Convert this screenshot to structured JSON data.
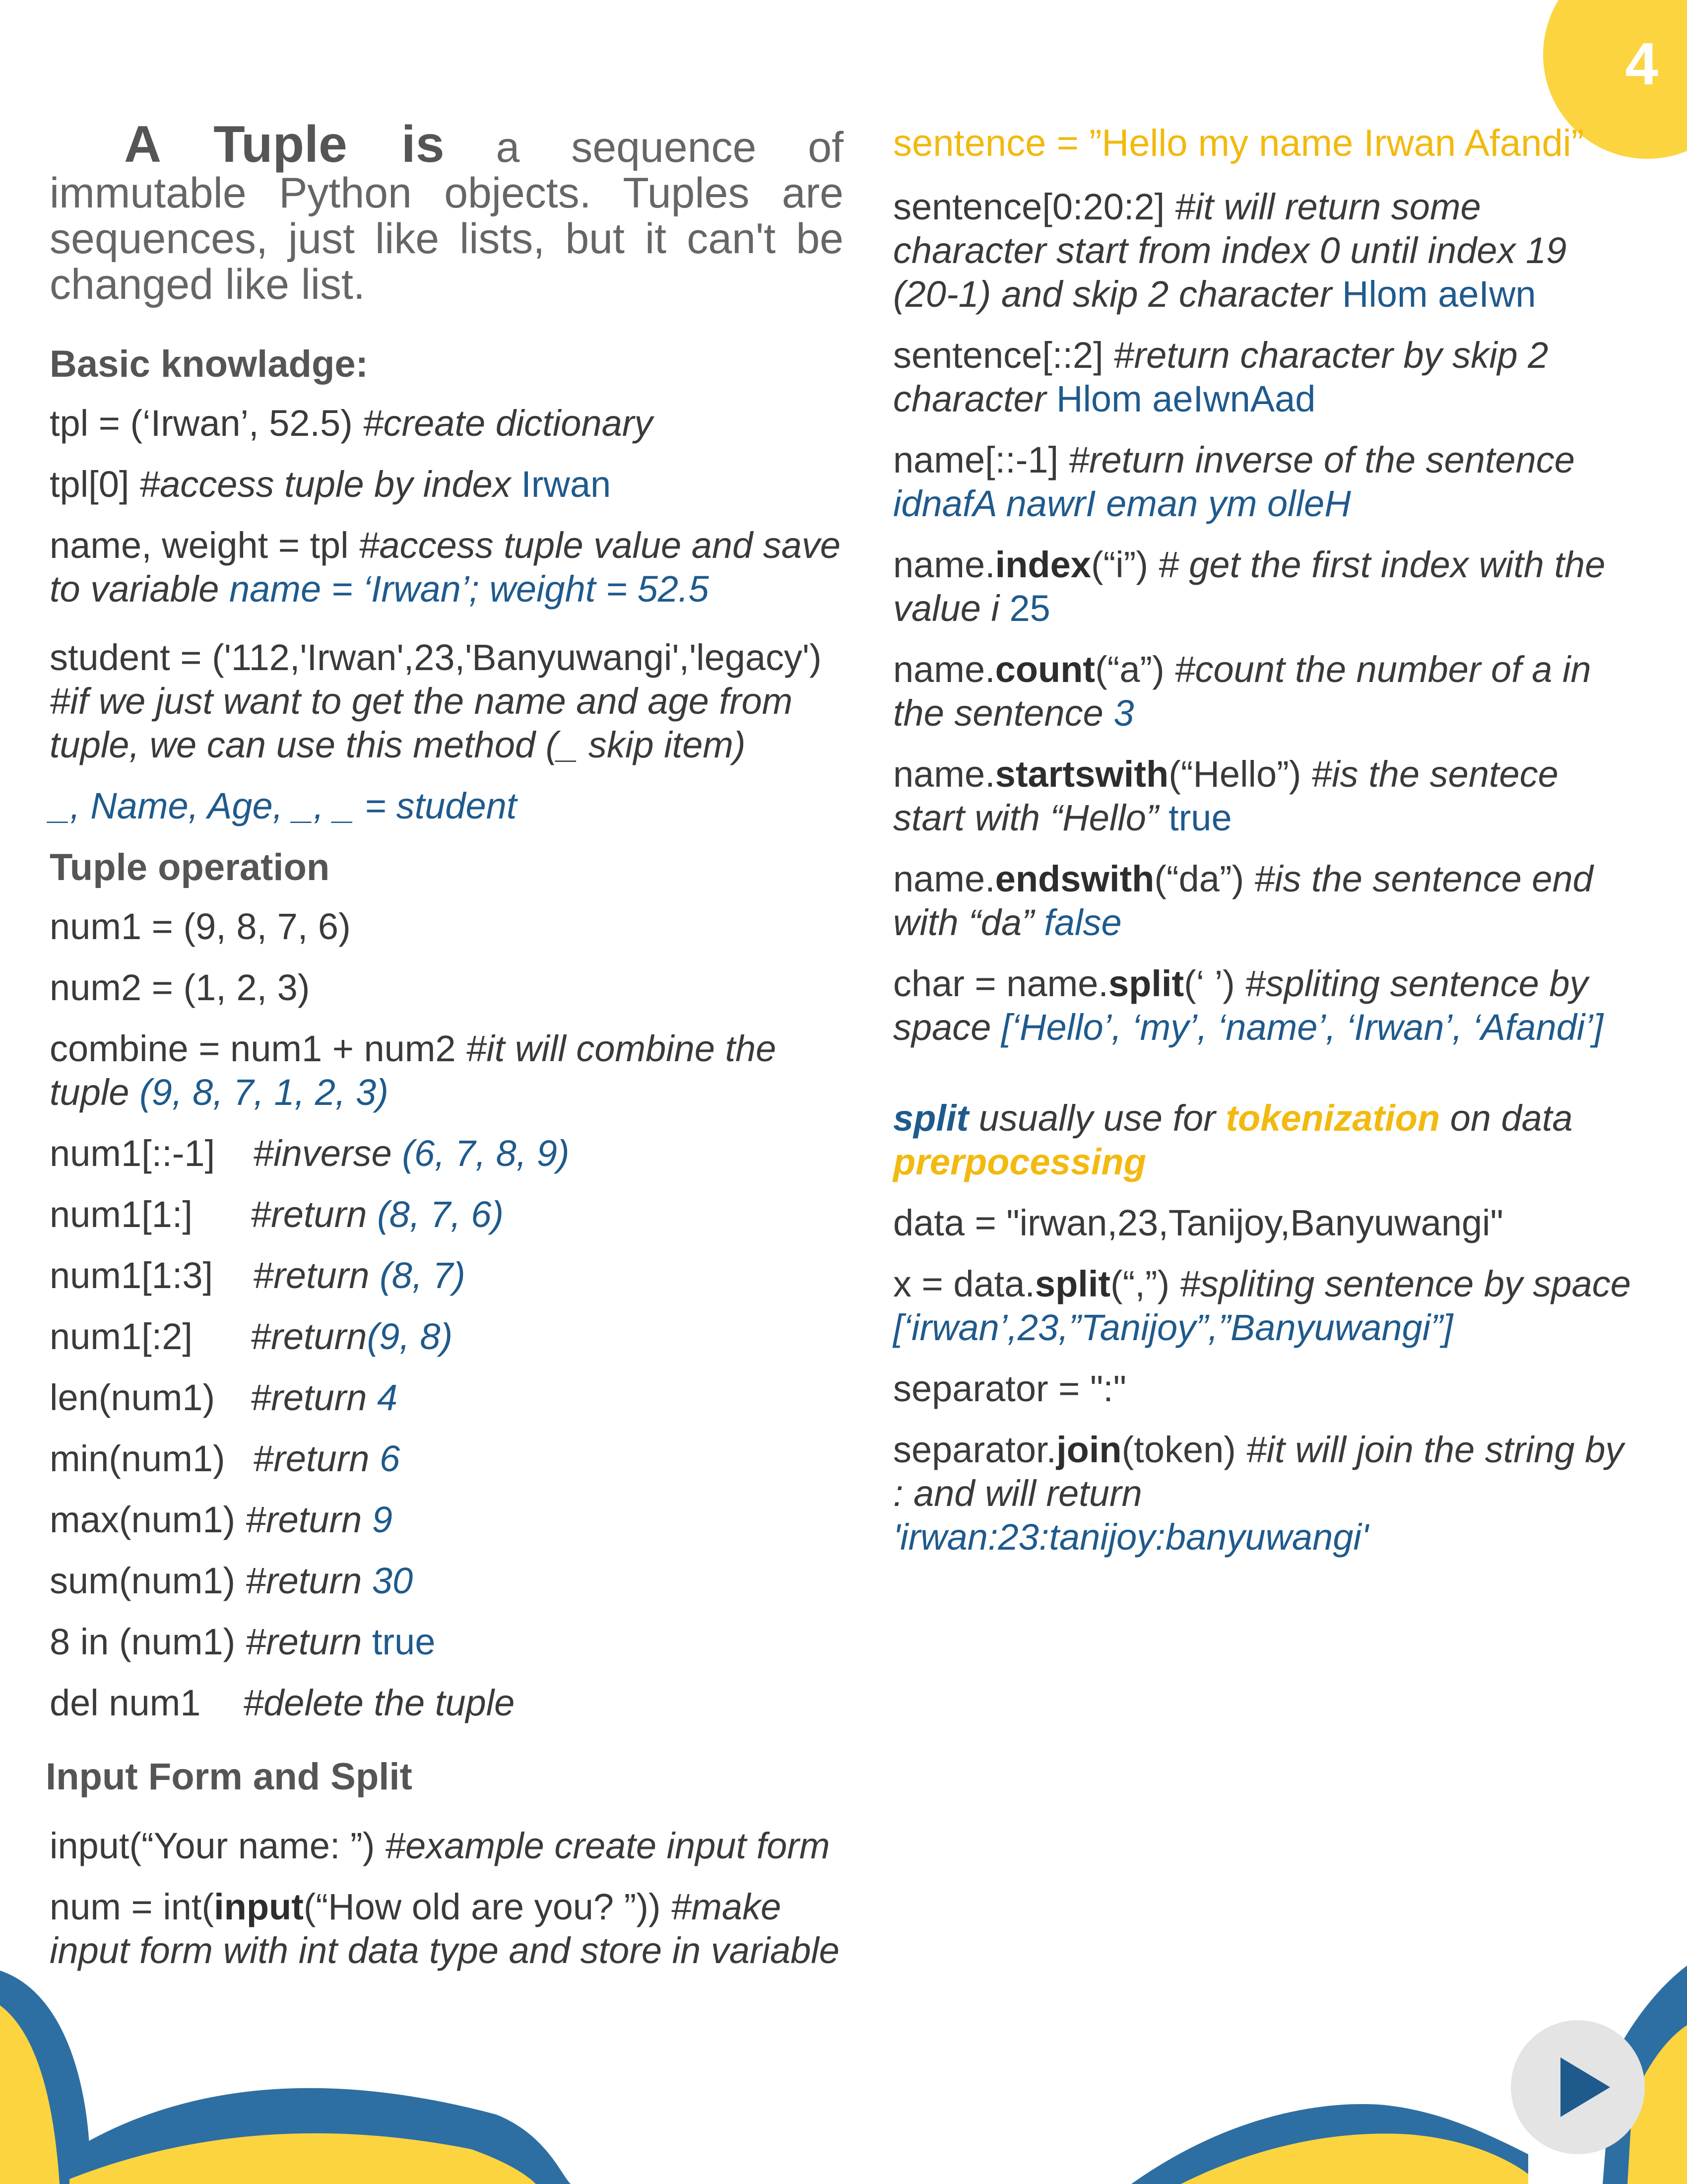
{
  "page_number": "4",
  "colors": {
    "accent_yellow": "#f2b90f",
    "accent_blue": "#1f5a8c",
    "wave_yellow": "#fcd440",
    "wave_blue": "#2e6fa3"
  },
  "icons": [
    "play-icon"
  ],
  "left": {
    "intro_bold": "A Tuple is",
    "intro_rest": " a sequence of immutable Python objects. Tuples are sequences, just like lists, but it can't be changed like list.",
    "basic_heading": "Basic knowladge:",
    "basic": [
      {
        "code": "tpl = (‘Irwan’, 52.5) ",
        "comment": "#create dictionary",
        "result": ""
      },
      {
        "code": "tpl[0] ",
        "comment": "#access tuple by index ",
        "result": "Irwan"
      },
      {
        "code": "name, weight = tpl ",
        "comment": "#access tuple value and save to variable ",
        "result": "name = ‘Irwan’; weight = 52.5"
      }
    ],
    "student_code": "student = ('112,'Irwan',23,'Banyuwangi','legacy')",
    "student_comment": "#if we just want to get the name and age from tuple, we can use this method (_ skip item)",
    "student_result": "_, Name, Age, _, _ = student",
    "tuple_heading": "Tuple operation",
    "ops": [
      {
        "code": "num1 = (9, 8, 7, 6)",
        "comment": "",
        "result": ""
      },
      {
        "code": "num2 = (1, 2, 3)",
        "comment": "",
        "result": ""
      },
      {
        "code": "combine = num1 + num2 ",
        "comment": "#it will combine the tuple ",
        "result": "(9, 8, 7, 1, 2, 3)"
      },
      {
        "code": "num1[::-1]",
        "comment": "#inverse ",
        "result": "(6, 7, 8, 9)"
      },
      {
        "code": "num1[1:]",
        "comment": "#return ",
        "result": "(8, 7, 6)"
      },
      {
        "code": "num1[1:3]",
        "comment": "#return ",
        "result": "(8, 7)"
      },
      {
        "code": "num1[:2]",
        "comment": "#return",
        "result": "(9, 8)"
      },
      {
        "code": "len(num1)",
        "comment": "#return ",
        "result": "4"
      },
      {
        "code": "min(num1)",
        "comment": "#return ",
        "result": "6"
      },
      {
        "code": "max(num1) ",
        "comment": "#return ",
        "result": "9"
      },
      {
        "code": "sum(num1) ",
        "comment": "#return ",
        "result": "30"
      },
      {
        "code": "8 in (num1) ",
        "comment": "#return ",
        "result": "true"
      },
      {
        "code": "del num1",
        "comment": "#delete the tuple",
        "result": ""
      }
    ],
    "input_heading": "Input Form and Split",
    "input1_code": "input(“Your name: ”) ",
    "input1_comment": "#example create input form",
    "input2_code_a": "num = int(",
    "input2_code_b": "input",
    "input2_code_c": "(“How old are you? ”)) ",
    "input2_comment": "#make input form with int data type and store in variable"
  },
  "right": {
    "sentence_line": "sentence = ”Hello my name Irwan Afandi”",
    "items": [
      {
        "pre": "sentence[0:20:2] ",
        "method": "",
        "post": "",
        "comment": "#it will return some character start from index 0 until index 19 (20-1) and skip 2 character ",
        "result": "Hlom aeIwn"
      },
      {
        "pre": "sentence[::2] ",
        "method": "",
        "post": "",
        "comment": "#return character by skip 2 character ",
        "result": "Hlom aeIwnAad"
      },
      {
        "pre": "name[::-1] ",
        "method": "",
        "post": "",
        "comment": "#return inverse of the sentence ",
        "result": "idnafA nawrI eman ym olleH"
      },
      {
        "pre": "name.",
        "method": "index",
        "post": "(“i”) ",
        "comment": "# get the first index with the value i ",
        "result": "25"
      },
      {
        "pre": "name.",
        "method": "count",
        "post": "(“a”) ",
        "comment": "#count the number of a in the sentence ",
        "result": "3"
      },
      {
        "pre": "name.",
        "method": "startswith",
        "post": "(“Hello”) ",
        "comment": "#is the sentece start with “Hello” ",
        "result": "true"
      },
      {
        "pre": "name.",
        "method": "endswith",
        "post": "(“da”) ",
        "comment": "#is the sentence end with “da” ",
        "result": "false"
      },
      {
        "pre": "char = name.",
        "method": "split",
        "post": "(‘ ’) ",
        "comment": "#spliting sentence by space ",
        "result": "[‘Hello’, ‘my’, ‘name’, ‘Irwan’, ‘Afandi’]"
      }
    ],
    "note_split": "split",
    "note_mid": " usually use for ",
    "note_token": "tokenization",
    "note_on": " on data ",
    "note_pre": "prerpocessing",
    "data_line": "data = \"irwan,23,Tanijoy,Banyuwangi\"",
    "x_pre": "x = data.",
    "x_method": "split",
    "x_post": "(“,”) ",
    "x_comment": "#spliting sentence by space ",
    "x_result": "[‘irwan’,23,”Tanijoy”,”Banyuwangi”]",
    "sep_line": "separator = \":\"",
    "join_pre": "separator.",
    "join_method": "join",
    "join_post": "(token) ",
    "join_comment": "#it will join the string by : and will return ",
    "join_result": "'irwan:23:tanijoy:banyuwangi'"
  }
}
